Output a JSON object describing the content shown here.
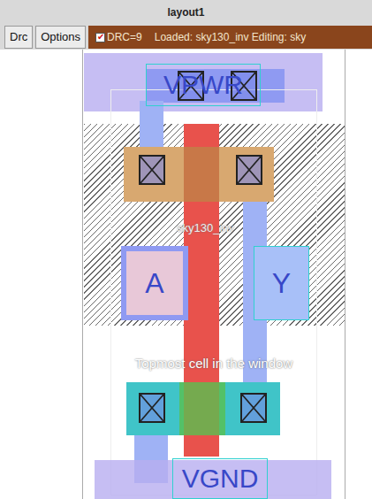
{
  "window": {
    "title": "layout1"
  },
  "toolbar": {
    "buttons": [
      "Drc",
      "Options"
    ],
    "drc": {
      "label": "DRC=9",
      "checked": true
    },
    "status": "Loaded: sky130_inv Editing: sky"
  },
  "layout": {
    "cell": "sky130_inv",
    "note": "Topmost cell in the window",
    "pins": [
      {
        "label": "VPWR"
      },
      {
        "label": "A"
      },
      {
        "label": "Y"
      },
      {
        "label": "VGND"
      }
    ]
  }
}
